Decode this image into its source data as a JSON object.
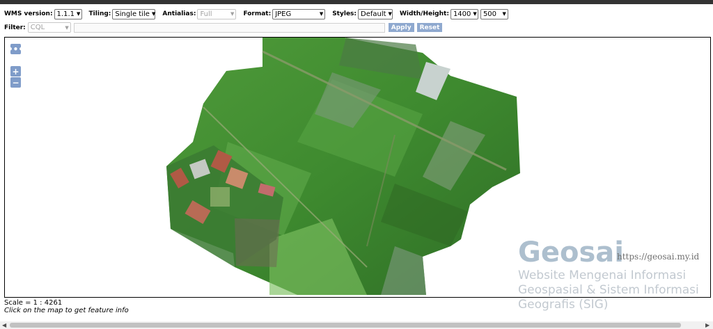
{
  "toolbar": {
    "wms_version": {
      "label": "WMS version:",
      "value": "1.1.1"
    },
    "tiling": {
      "label": "Tiling:",
      "value": "Single tile"
    },
    "antialias": {
      "label": "Antialias:",
      "value": "Full"
    },
    "format": {
      "label": "Format:",
      "value": "JPEG"
    },
    "styles": {
      "label": "Styles:",
      "value": "Default"
    },
    "width_height": {
      "label": "Width/Height:",
      "width": "1400",
      "height": "500"
    }
  },
  "filter": {
    "label": "Filter:",
    "type_value": "CQL",
    "expression": "",
    "apply_label": "Apply",
    "reset_label": "Reset"
  },
  "map": {
    "pan_button": "•••",
    "zoom_in": "+",
    "zoom_out": "−"
  },
  "status": {
    "scale": "Scale = 1 : 4261",
    "hint": "Click on the map to get feature info"
  },
  "watermark": {
    "title": "Geosai",
    "url": "https://geosai.my.id",
    "subtitle": "Website Mengenai Informasi Geospasial & Sistem Informasi Geografis (SIG)"
  },
  "colors": {
    "button_blue": "#7f9cc9",
    "field_green": "#3f8a2c",
    "roof_red": "#b05a45"
  }
}
